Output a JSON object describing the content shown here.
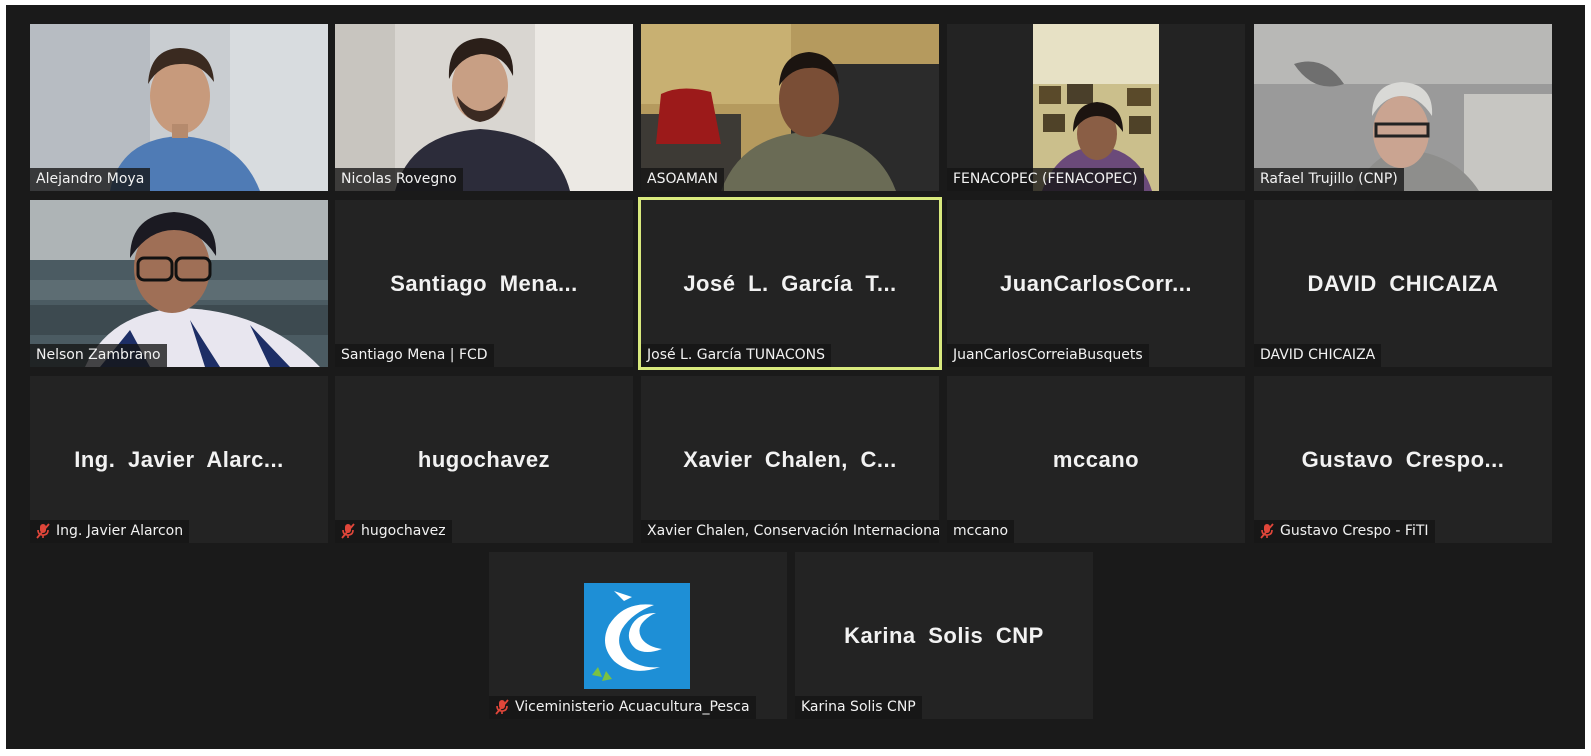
{
  "participants": [
    {
      "label": "Alejandro Moya",
      "display": "",
      "muted": false,
      "video": true
    },
    {
      "label": "Nicolas Rovegno",
      "display": "",
      "muted": false,
      "video": true
    },
    {
      "label": "ASOAMAN",
      "display": "",
      "muted": false,
      "video": true
    },
    {
      "label": "FENACOPEC (FENACOPEC)",
      "display": "",
      "muted": false,
      "video": true
    },
    {
      "label": "Rafael Trujillo (CNP)",
      "display": "",
      "muted": false,
      "video": true
    },
    {
      "label": "Nelson Zambrano",
      "display": "",
      "muted": false,
      "video": true
    },
    {
      "label": "Santiago Mena | FCD",
      "display": "Santiago  Mena...",
      "muted": false,
      "video": false
    },
    {
      "label": "José L. García TUNACONS",
      "display": "José  L.  García  T...",
      "muted": false,
      "video": false,
      "active": true
    },
    {
      "label": "JuanCarlosCorreiaBusquets",
      "display": "JuanCarlosCorr...",
      "muted": false,
      "video": false
    },
    {
      "label": "DAVID CHICAIZA",
      "display": "DAVID  CHICAIZA",
      "muted": false,
      "video": false
    },
    {
      "label": "Ing. Javier Alarcon",
      "display": "Ing.  Javier  Alarc...",
      "muted": true,
      "video": false
    },
    {
      "label": "hugochavez",
      "display": "hugochavez",
      "muted": true,
      "video": false
    },
    {
      "label": "Xavier Chalen, Conservación Internacional",
      "display": "Xavier  Chalen,  C...",
      "muted": false,
      "video": false
    },
    {
      "label": "mccano",
      "display": "mccano",
      "muted": false,
      "video": false
    },
    {
      "label": "Gustavo Crespo - FiTI",
      "display": "Gustavo  Crespo...",
      "muted": true,
      "video": false
    },
    {
      "label": "Viceministerio Acuacultura_Pesca",
      "display": "",
      "muted": true,
      "video": false,
      "logo": true
    },
    {
      "label": "Karina Solis CNP",
      "display": "Karina  Solis  CNP",
      "muted": false,
      "video": false
    }
  ],
  "colors": {
    "active_border": "#d9ea7e",
    "muted_icon": "#e0463a",
    "logo_bg": "#1e8fd6"
  },
  "icons": {
    "muted": "microphone-muted-icon"
  }
}
